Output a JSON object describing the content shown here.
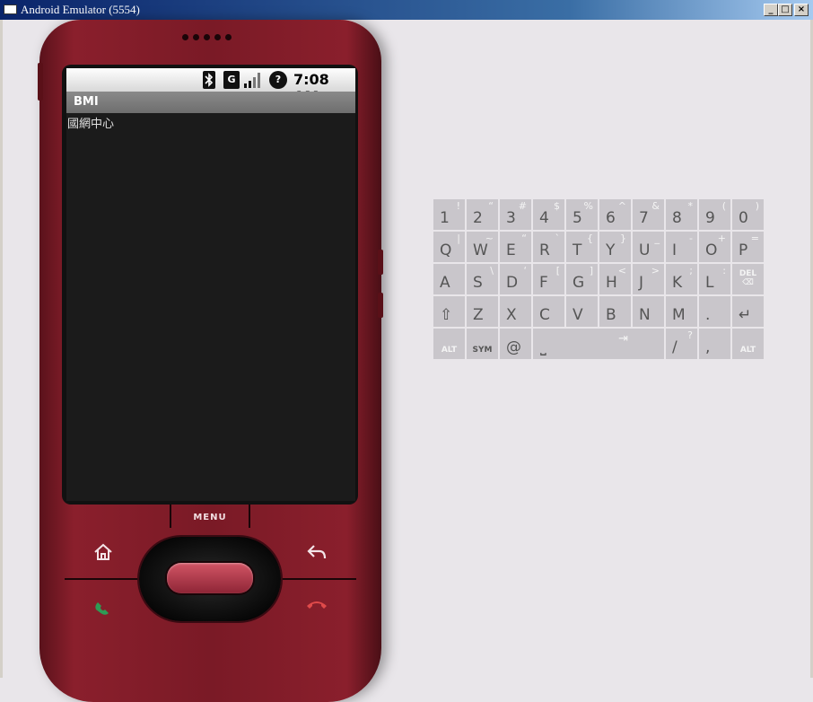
{
  "window": {
    "title": "Android Emulator (5554)",
    "minimize": "_",
    "maximize": "□",
    "close": "×"
  },
  "phone": {
    "status_bar": {
      "clock": "7:08 AM",
      "network": "G",
      "alert": "?"
    },
    "app": {
      "title": "BMI",
      "content_text": "國網中心"
    },
    "menu_label": "MENU"
  },
  "keyboard": {
    "rows": [
      [
        {
          "main": "1",
          "alt": "!"
        },
        {
          "main": "2",
          "alt": "“"
        },
        {
          "main": "3",
          "alt": "#"
        },
        {
          "main": "4",
          "alt": "$"
        },
        {
          "main": "5",
          "alt": "%"
        },
        {
          "main": "6",
          "alt": "^"
        },
        {
          "main": "7",
          "alt": "&"
        },
        {
          "main": "8",
          "alt": "*"
        },
        {
          "main": "9",
          "alt": "("
        },
        {
          "main": "0",
          "alt": ")"
        }
      ],
      [
        {
          "main": "Q",
          "alt": "|"
        },
        {
          "main": "W",
          "alt": "~"
        },
        {
          "main": "E",
          "alt": "“"
        },
        {
          "main": "R",
          "alt": "`"
        },
        {
          "main": "T",
          "alt": "{"
        },
        {
          "main": "Y",
          "alt": "}"
        },
        {
          "main": "U",
          "alt": "_"
        },
        {
          "main": "I",
          "alt": "-"
        },
        {
          "main": "O",
          "alt": "+"
        },
        {
          "main": "P",
          "alt": "="
        }
      ],
      [
        {
          "main": "A",
          "alt": ""
        },
        {
          "main": "S",
          "alt": "\\"
        },
        {
          "main": "D",
          "alt": "‘"
        },
        {
          "main": "F",
          "alt": "["
        },
        {
          "main": "G",
          "alt": "]"
        },
        {
          "main": "H",
          "alt": "<"
        },
        {
          "main": "J",
          "alt": ">"
        },
        {
          "main": "K",
          "alt": ";"
        },
        {
          "main": "L",
          "alt": ":"
        },
        {
          "main": "",
          "alt": "",
          "small": "DEL ⌫"
        }
      ],
      [
        {
          "main": "⇧",
          "alt": ""
        },
        {
          "main": "Z",
          "alt": ""
        },
        {
          "main": "X",
          "alt": ""
        },
        {
          "main": "C",
          "alt": ""
        },
        {
          "main": "V",
          "alt": ""
        },
        {
          "main": "B",
          "alt": ""
        },
        {
          "main": "N",
          "alt": ""
        },
        {
          "main": "M",
          "alt": ""
        },
        {
          "main": ".",
          "alt": ""
        },
        {
          "main": "↵",
          "alt": ""
        }
      ]
    ],
    "bottom_row": {
      "alt_left": "ALT",
      "sym": "SYM",
      "at": "@",
      "space": "⎵",
      "tab": "⇥",
      "slash": "/",
      "question": "?",
      "comma": ",",
      "alt_right": "ALT"
    }
  }
}
